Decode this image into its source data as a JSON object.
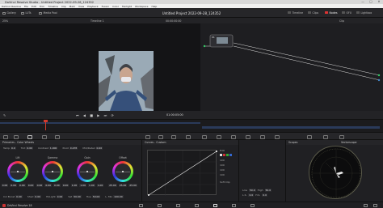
{
  "window": {
    "title": "DaVinci Resolve Studio - Untitled Project 2022-09-28_124352",
    "controls": [
      "—",
      "□",
      "✕"
    ]
  },
  "menubar": {
    "items": [
      "DaVinci Resolve",
      "File",
      "Edit",
      "Trim",
      "Timeline",
      "Clip",
      "Mark",
      "View",
      "Playback",
      "Fusion",
      "Color",
      "Fairlight",
      "Workspace",
      "Help"
    ]
  },
  "toolbar": {
    "left": [
      {
        "label": "Gallery",
        "icon": "gallery-icon"
      },
      {
        "label": "LUTs",
        "icon": "luts-icon"
      },
      {
        "label": "Media Pool",
        "icon": "media-pool-icon"
      }
    ],
    "project_title": "Untitled Project 2022-09-28_124352",
    "right": [
      {
        "label": "Timeline",
        "icon": "timeline-icon"
      },
      {
        "label": "Clips",
        "icon": "clips-icon"
      },
      {
        "label": "Nodes",
        "icon": "nodes-icon"
      },
      {
        "label": "OFX",
        "icon": "ofx-icon"
      },
      {
        "label": "Lightbox",
        "icon": "lightbox-icon"
      }
    ]
  },
  "viewer": {
    "zoom": "25%",
    "timeline_name": "Timeline 1",
    "timecode_left": "00:00:00:00",
    "timecode_right": "01:00:05:00"
  },
  "node_editor": {
    "mode": "Clip",
    "node_label": "01"
  },
  "wheels": {
    "title": "Primaries - Color Wheels",
    "top_params": [
      {
        "label": "Temp",
        "value": "0.0"
      },
      {
        "label": "Tint",
        "value": "0.00"
      },
      {
        "label": "Contrast",
        "value": "1.000"
      },
      {
        "label": "Pivot",
        "value": "0.435"
      },
      {
        "label": "Mid/Detail",
        "value": "0.00"
      }
    ],
    "items": [
      {
        "name": "Lift",
        "vals": [
          "0.00",
          "0.00",
          "0.00",
          "0.00"
        ]
      },
      {
        "name": "Gamma",
        "vals": [
          "0.00",
          "0.00",
          "0.00",
          "0.00"
        ]
      },
      {
        "name": "Gain",
        "vals": [
          "1.00",
          "1.00",
          "1.00",
          "1.00"
        ]
      },
      {
        "name": "Offset",
        "vals": [
          "25.00",
          "25.00",
          "25.00"
        ]
      }
    ],
    "bottom_params": [
      {
        "label": "Col Boost",
        "value": "0.00"
      },
      {
        "label": "Shad",
        "value": "0.00"
      },
      {
        "label": "Hi/Light",
        "value": "0.00"
      },
      {
        "label": "Sat",
        "value": "50.00"
      },
      {
        "label": "Hue",
        "value": "50.00"
      },
      {
        "label": "L. Mix",
        "value": "100.00"
      }
    ]
  },
  "curves": {
    "title": "Curves - Custom",
    "side_vals": [
      "100",
      "100",
      "100",
      "100"
    ],
    "soft_clip": "Soft Clip",
    "edit_label": "Edit"
  },
  "qualifier": {
    "low": "Low",
    "high": "High",
    "low_val": "50.0",
    "high_val": "50.0",
    "ls": "L.S.",
    "hs": "H.S.",
    "ls_val": "0.0",
    "hs_val": "0.0"
  },
  "scopes": {
    "title": "Scopes",
    "mode": "Vectorscope"
  },
  "status": {
    "app": "DaVinci Resolve 18"
  },
  "colors": {
    "accent": "#d33a2c",
    "active_page": "#e0e0e0"
  }
}
